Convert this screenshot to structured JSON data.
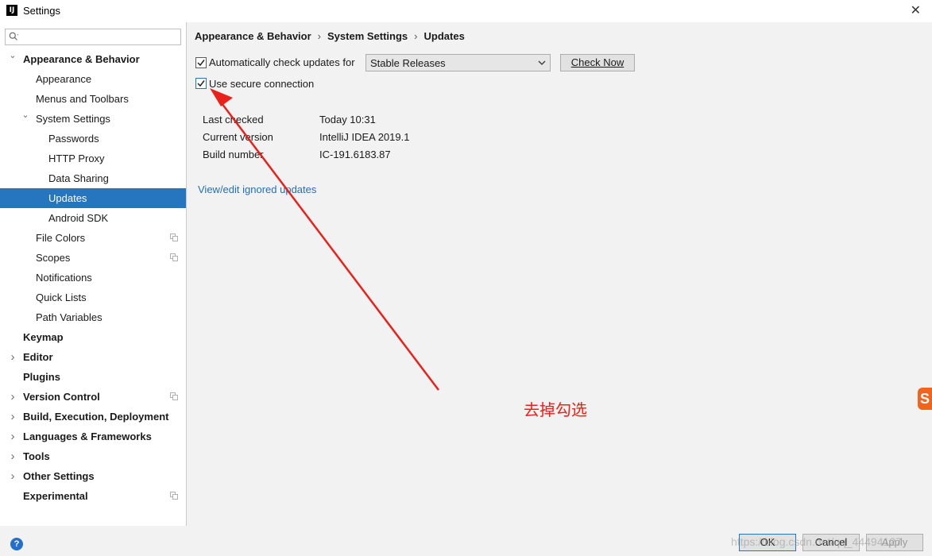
{
  "window": {
    "title": "Settings",
    "app_icon": "intellij-icon"
  },
  "search": {
    "icon": "search-icon",
    "value": ""
  },
  "sidebar": {
    "items": [
      {
        "label": "Appearance & Behavior",
        "level": 0,
        "bold": true,
        "expander": "expanded"
      },
      {
        "label": "Appearance",
        "level": 1
      },
      {
        "label": "Menus and Toolbars",
        "level": 1
      },
      {
        "label": "System Settings",
        "level": 1,
        "expander": "expanded"
      },
      {
        "label": "Passwords",
        "level": 2
      },
      {
        "label": "HTTP Proxy",
        "level": 2
      },
      {
        "label": "Data Sharing",
        "level": 2
      },
      {
        "label": "Updates",
        "level": 2,
        "selected": true
      },
      {
        "label": "Android SDK",
        "level": 2
      },
      {
        "label": "File Colors",
        "level": 1,
        "project_icon": true
      },
      {
        "label": "Scopes",
        "level": 1,
        "project_icon": true
      },
      {
        "label": "Notifications",
        "level": 1
      },
      {
        "label": "Quick Lists",
        "level": 1
      },
      {
        "label": "Path Variables",
        "level": 1
      },
      {
        "label": "Keymap",
        "level": 0,
        "bold": true
      },
      {
        "label": "Editor",
        "level": 0,
        "bold": true,
        "expander": "collapsed"
      },
      {
        "label": "Plugins",
        "level": 0,
        "bold": true
      },
      {
        "label": "Version Control",
        "level": 0,
        "bold": true,
        "expander": "collapsed",
        "project_icon": true
      },
      {
        "label": "Build, Execution, Deployment",
        "level": 0,
        "bold": true,
        "expander": "collapsed"
      },
      {
        "label": "Languages & Frameworks",
        "level": 0,
        "bold": true,
        "expander": "collapsed"
      },
      {
        "label": "Tools",
        "level": 0,
        "bold": true,
        "expander": "collapsed"
      },
      {
        "label": "Other Settings",
        "level": 0,
        "bold": true,
        "expander": "collapsed"
      },
      {
        "label": "Experimental",
        "level": 0,
        "bold": true,
        "project_icon": true
      }
    ]
  },
  "breadcrumb": {
    "part1": "Appearance & Behavior",
    "part2": "System Settings",
    "part3": "Updates",
    "separator": "›"
  },
  "updates": {
    "auto_check_label": "Automatically check updates for",
    "auto_check_checked": true,
    "channel_value": "Stable Releases",
    "check_now_label": "Check Now",
    "secure_label": "Use secure connection",
    "secure_checked": true,
    "info": {
      "last_checked_label": "Last checked",
      "last_checked_value": "Today 10:31",
      "current_version_label": "Current version",
      "current_version_value": "IntelliJ IDEA 2019.1",
      "build_number_label": "Build number",
      "build_number_value": "IC-191.6183.87"
    },
    "ignored_link": "View/edit ignored updates"
  },
  "annotation": {
    "text": "去掉勾选",
    "color": "#e8221b"
  },
  "footer": {
    "ok_label": "OK",
    "cancel_label": "Cancel",
    "apply_label": "Apply",
    "help_icon": "help-icon"
  },
  "watermark": "https://blog.csdn.net/qq_44494127",
  "colors": {
    "selection": "#2675bf",
    "link": "#2470b3",
    "annotation": "#e8221b",
    "help": "#2470c9"
  }
}
